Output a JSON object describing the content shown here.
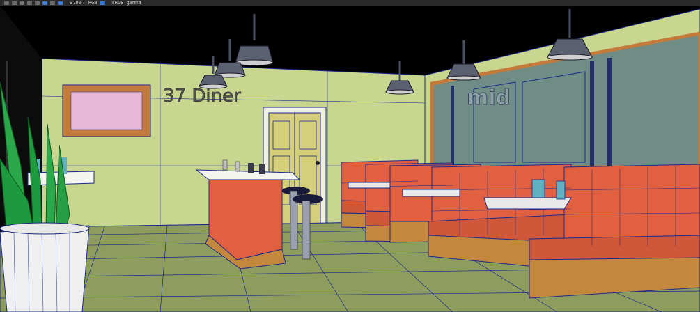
{
  "toolbar": {
    "zoom_value": "0.00",
    "render_mode": "RGB",
    "color_space": "sRGB gamma"
  },
  "scene": {
    "diner_sign": "37 Diner",
    "neon_sign": "mid"
  },
  "colors": {
    "wireframe": "#1a2a8c",
    "wall": "#c9d690",
    "floor": "#8e9d5e",
    "booth": "#e06040",
    "booth_base": "#c4873e",
    "glass": "#6f8d85",
    "frame": "#c47a3a"
  },
  "icons": [
    "undo-icon",
    "redo-icon",
    "select-icon",
    "move-icon",
    "rotate-icon",
    "scale-icon",
    "snap-icon",
    "render-icon",
    "color-icon"
  ]
}
